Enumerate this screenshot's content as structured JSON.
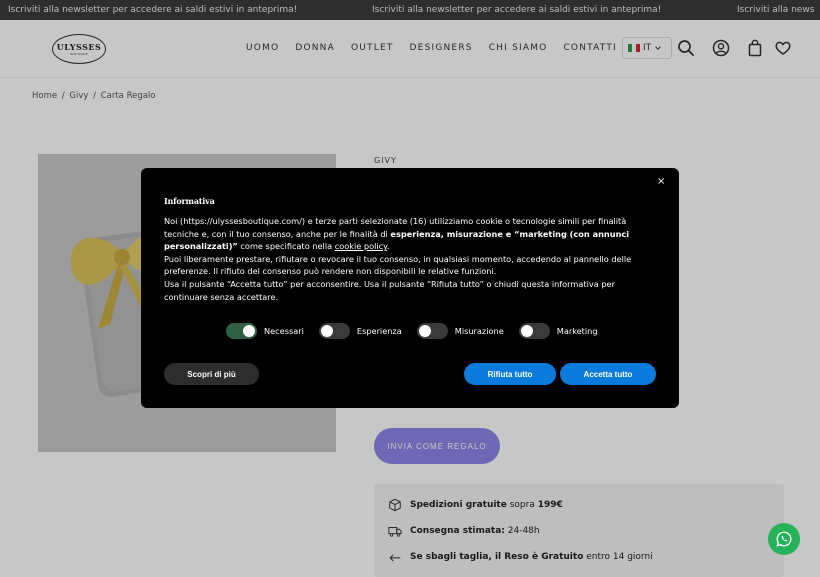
{
  "announcement": {
    "text": "Iscriviti alla newsletter per accedere ai saldi estivi in anteprima!",
    "text_cut": "Iscriviti alla news"
  },
  "header": {
    "logo": {
      "line1": "ULYSSES",
      "line2": "BOUTIQUE"
    },
    "nav": [
      "UOMO",
      "DONNA",
      "OUTLET",
      "DESIGNERS",
      "CHI SIAMO",
      "CONTATTI"
    ],
    "language": "IT",
    "icons": [
      "search-icon",
      "account-icon",
      "bag-icon",
      "heart-icon"
    ]
  },
  "breadcrumb": {
    "home": "Home",
    "sep": "/",
    "brand": "Givy",
    "current": "Carta Regalo"
  },
  "product": {
    "brand": "GIVY",
    "gift_button": "INVIA COME REGALO",
    "info": [
      {
        "icon": "box-icon",
        "bold": "Spedizioni gratuite",
        "rest": " sopra ",
        "bold2": "199€"
      },
      {
        "icon": "truck-icon",
        "bold": "Consegna stimata:",
        "rest": " 24-48h",
        "bold2": ""
      },
      {
        "icon": "return-icon",
        "bold": "Se sbagli taglia, il Reso è Gratuito",
        "rest": " entro 14 giorni",
        "bold2": ""
      }
    ]
  },
  "cookie": {
    "title": "Informativa",
    "close": "×",
    "p1_a": "Noi (https://ulyssesboutique.com/) e terze parti selezionate (16) utilizziamo cookie o tecnologie simili per finalità tecniche e, con il tuo consenso, anche per le finalità di ",
    "p1_b": "esperienza, misurazione e “marketing (con annunci personalizzati)”",
    "p1_c": " come specificato nella ",
    "p1_link": "cookie policy",
    "p1_d": ".",
    "p2": "Puoi liberamente prestare, rifiutare o revocare il tuo consenso, in qualsiasi momento, accedendo al pannello delle preferenze. Il rifiuto del consenso può rendere non disponibili le relative funzioni.",
    "p3": "Usa il pulsante “Accetta tutto” per acconsentire. Usa il pulsante “Rifiuta tutto” o chiudi questa informativa per continuare senza accettare.",
    "toggles": [
      {
        "label": "Necessari",
        "on": true
      },
      {
        "label": "Esperienza",
        "on": false
      },
      {
        "label": "Misurazione",
        "on": false
      },
      {
        "label": "Marketing",
        "on": false
      }
    ],
    "learn_more": "Scopri di più",
    "reject": "Rifiuta tutto",
    "accept": "Accetta tutto"
  },
  "colors": {
    "gift_button": "#8f86e8",
    "cookie_primary": "#0a7bdc",
    "whatsapp": "#25b35a"
  }
}
